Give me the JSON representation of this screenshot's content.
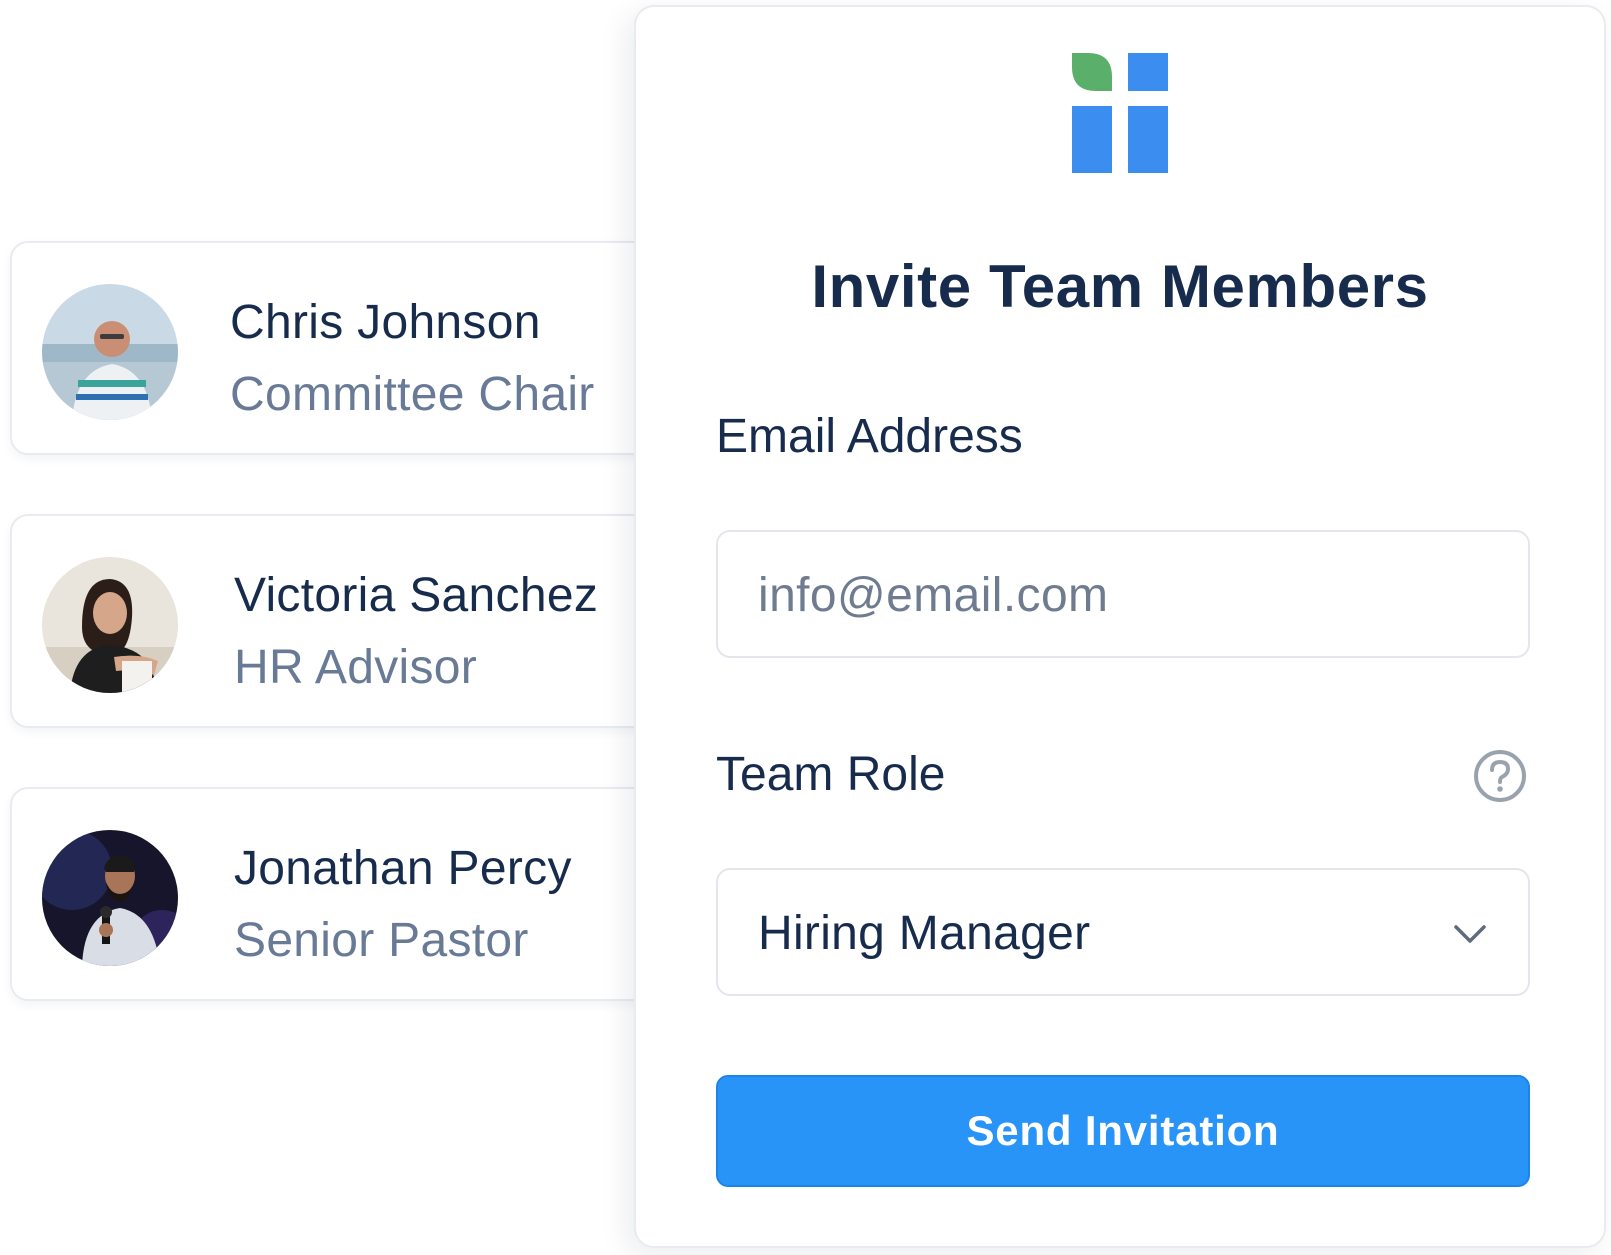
{
  "members": [
    {
      "name": "Chris Johnson",
      "role": "Committee Chair"
    },
    {
      "name": "Victoria Sanchez",
      "role": "HR Advisor"
    },
    {
      "name": "Jonathan Percy",
      "role": "Senior Pastor"
    }
  ],
  "invite_form": {
    "title": "Invite Team Members",
    "email_label": "Email Address",
    "email_placeholder": "info@email.com",
    "role_label": "Team Role",
    "role_selected": "Hiring Manager",
    "submit_label": "Send Invitation"
  },
  "colors": {
    "accent": "#2994f8",
    "logo_blue": "#3b8ef0",
    "logo_green": "#5aaf6a",
    "text_primary": "#172b4d",
    "text_secondary": "#687a96"
  },
  "icons": {
    "brand": "brand-logo",
    "help": "question-circle-icon",
    "select": "chevron-down-icon"
  }
}
